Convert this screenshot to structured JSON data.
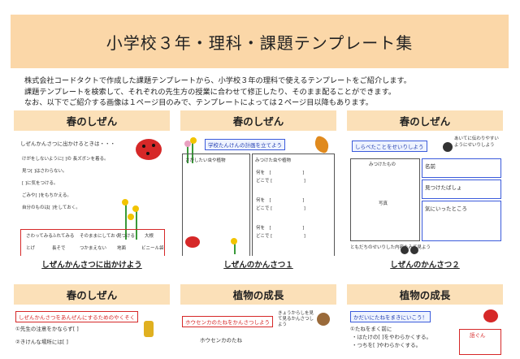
{
  "banner": {
    "title": "小学校３年・理科・課題テンプレート集"
  },
  "intro": {
    "line1": "株式会社コードタクトで作成した課題テンプレートから、小学校３年の理科で使えるテンプレートをご紹介します。",
    "line2": "課題テンプレートを検索して、それぞれの先生方の授業に合わせて修正したり、そのまま配ることができます。",
    "line3": "なお、以下でご紹介する画像は１ページ目のみで、テンプレートによっては２ページ目以降もあります。"
  },
  "cards": [
    {
      "heading": "春のしぜん",
      "caption": "しぜんかんさつに出かけよう",
      "thumb": {
        "title": "しぜんかんさつに出かけるときは・・・",
        "lines": [
          "けがをしないように[ ]の 長ズボンを着る。",
          "見つ[ ]はさわらない。",
          "[ ]に気をつける。",
          "ごみや[ ]をもちかえる。",
          "自分のものは[ ]をしておく。"
        ],
        "grid": [
          "さわってみる",
          "ふれてみる",
          "そのままにしておく",
          "見つける",
          "大根",
          "とげ",
          "長そで",
          "つかまえない",
          "地面",
          "ビニール袋"
        ]
      }
    },
    {
      "heading": "春のしぜん",
      "caption": "しぜんのかんさつ１",
      "thumb": {
        "tag": "学校たんけんの計画を立てよう",
        "left_label": "さがしたい虫や植物",
        "right_label": "みつけた虫や植物",
        "rows": [
          "何を　[　　　　　　　]",
          "どこで [　　　　　　　]"
        ]
      }
    },
    {
      "heading": "春のしぜん",
      "caption": "しぜんのかんさつ２",
      "thumb": {
        "tag": "しらべたことをせいりしよう",
        "quote": "あいてに伝わりやすいようにせいりしよう",
        "found_label": "みつけたもの",
        "photo_label": "写真",
        "fields": [
          "名前",
          "見つけたばしょ",
          "気にいったところ"
        ],
        "footer": "ともだちのせいりした内容をみて見よう"
      }
    },
    {
      "heading": "春のしぜん",
      "caption": "",
      "thumb": {
        "tag": "しぜんかんさつをあんぜんにするためのやくそく",
        "lines": [
          "①先生の注意をかならず[ ]",
          "②きけんな場所には[ ]"
        ]
      }
    },
    {
      "heading": "植物の成長",
      "caption": "",
      "thumb": {
        "tag": "ホウセンカのたねをかんさつしよう",
        "sub": "ホウセンカのたね",
        "bubble": "きょうからしを見て見るかんさつしよう"
      }
    },
    {
      "heading": "植物の成長",
      "caption": "",
      "thumb": {
        "tag": "かだいにたねをまきにいこう！",
        "lines": [
          "①たねをまく前に",
          "・はたけの[ ]をやわらかくする。",
          "・つちを[ ]やわらかくする。"
        ],
        "label": "語ぐん"
      }
    }
  ],
  "colors": {
    "banner": "#fbd7a8",
    "card_head": "#fbe0b8",
    "red": "#d62828",
    "blue": "#3b5bdb"
  }
}
